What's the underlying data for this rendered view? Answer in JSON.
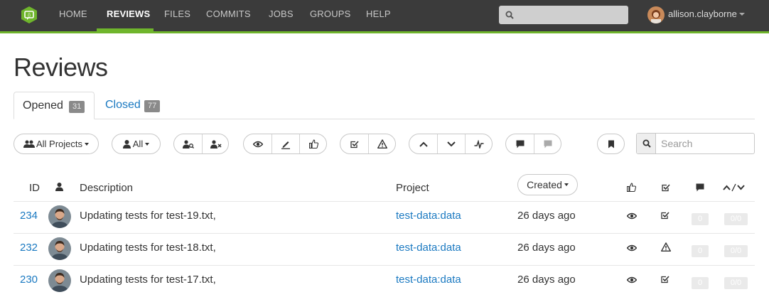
{
  "nav": {
    "items": [
      {
        "label": "HOME",
        "active": false
      },
      {
        "label": "REVIEWS",
        "active": true
      },
      {
        "label": "FILES",
        "active": false
      },
      {
        "label": "COMMITS",
        "active": false
      },
      {
        "label": "JOBS",
        "active": false
      },
      {
        "label": "GROUPS",
        "active": false
      },
      {
        "label": "HELP",
        "active": false
      }
    ],
    "username": "allison.clayborne",
    "accent_color": "#6fb52c"
  },
  "page": {
    "title": "Reviews"
  },
  "tabs": [
    {
      "label": "Opened",
      "count": "31",
      "active": true
    },
    {
      "label": "Closed",
      "count": "77",
      "active": false
    }
  ],
  "filters": {
    "projects_label": "All Projects",
    "users_label": "All",
    "search_placeholder": "Search"
  },
  "table": {
    "headers": {
      "id": "ID",
      "description": "Description",
      "project": "Project",
      "sort": "Created"
    },
    "rows": [
      {
        "id": "234",
        "description": "Updating tests for test-19.txt,",
        "project": "test-data:data",
        "time": "26 days ago",
        "test_status": "pass",
        "comments": "0",
        "votes": "0/0"
      },
      {
        "id": "232",
        "description": "Updating tests for test-18.txt,",
        "project": "test-data:data",
        "time": "26 days ago",
        "test_status": "fail",
        "comments": "0",
        "votes": "0/0"
      },
      {
        "id": "230",
        "description": "Updating tests for test-17.txt,",
        "project": "test-data:data",
        "time": "26 days ago",
        "test_status": "pass",
        "comments": "0",
        "votes": "0/0"
      }
    ]
  }
}
